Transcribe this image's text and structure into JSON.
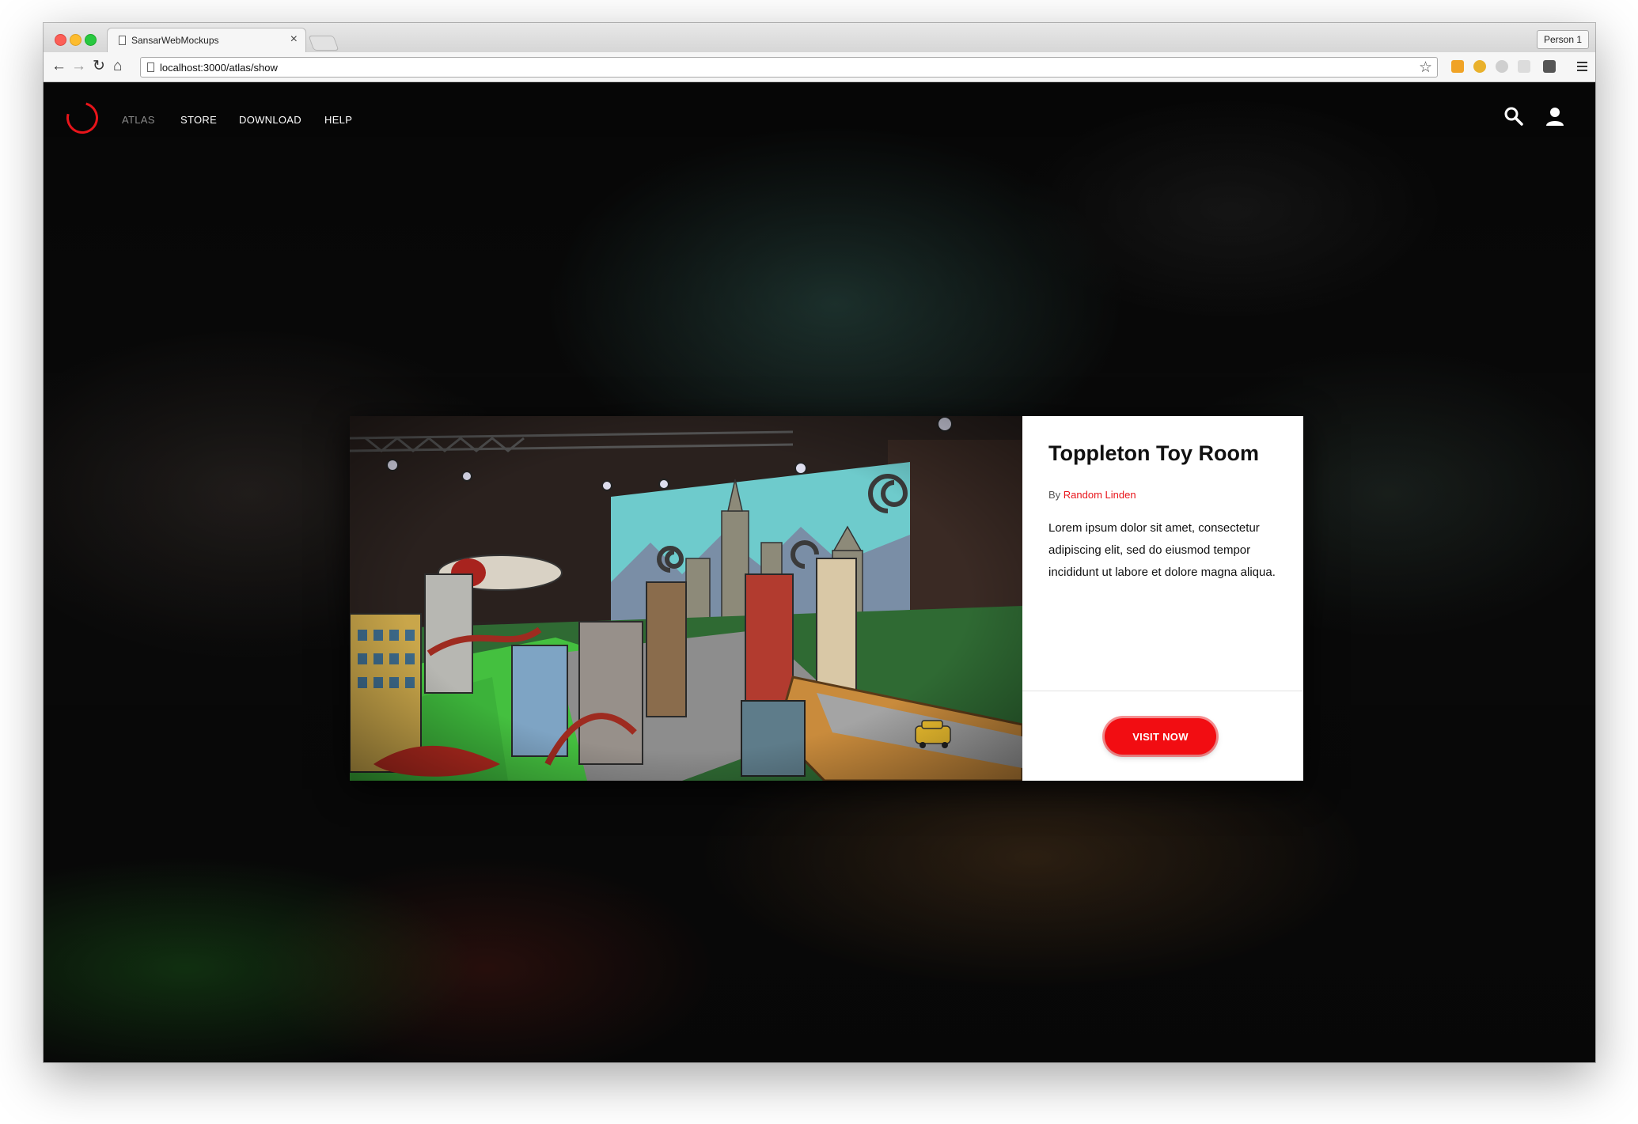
{
  "browser": {
    "tab_title": "SansarWebMockups",
    "tab_close": "×",
    "url": "localhost:3000/atlas/show",
    "profile": "Person 1"
  },
  "site": {
    "nav": [
      "ATLAS",
      "STORE",
      "DOWNLOAD",
      "HELP"
    ],
    "active_nav": "ATLAS",
    "accent_color": "#e8141a"
  },
  "experience": {
    "title": "Toppleton Toy Room",
    "by_label": "By",
    "author": "Random Linden",
    "description": "Lorem ipsum dolor sit amet, consectetur adipiscing elit, sed do eiusmod tempor incididunt ut labore et dolore magna aliqua.",
    "cta": "VISIT NOW"
  },
  "icons": {
    "header": [
      "search-icon",
      "account-icon"
    ],
    "toolbar": [
      "back-icon",
      "forward-icon",
      "reload-icon",
      "home-icon",
      "bookmark-star-icon",
      "menu-icon"
    ]
  }
}
